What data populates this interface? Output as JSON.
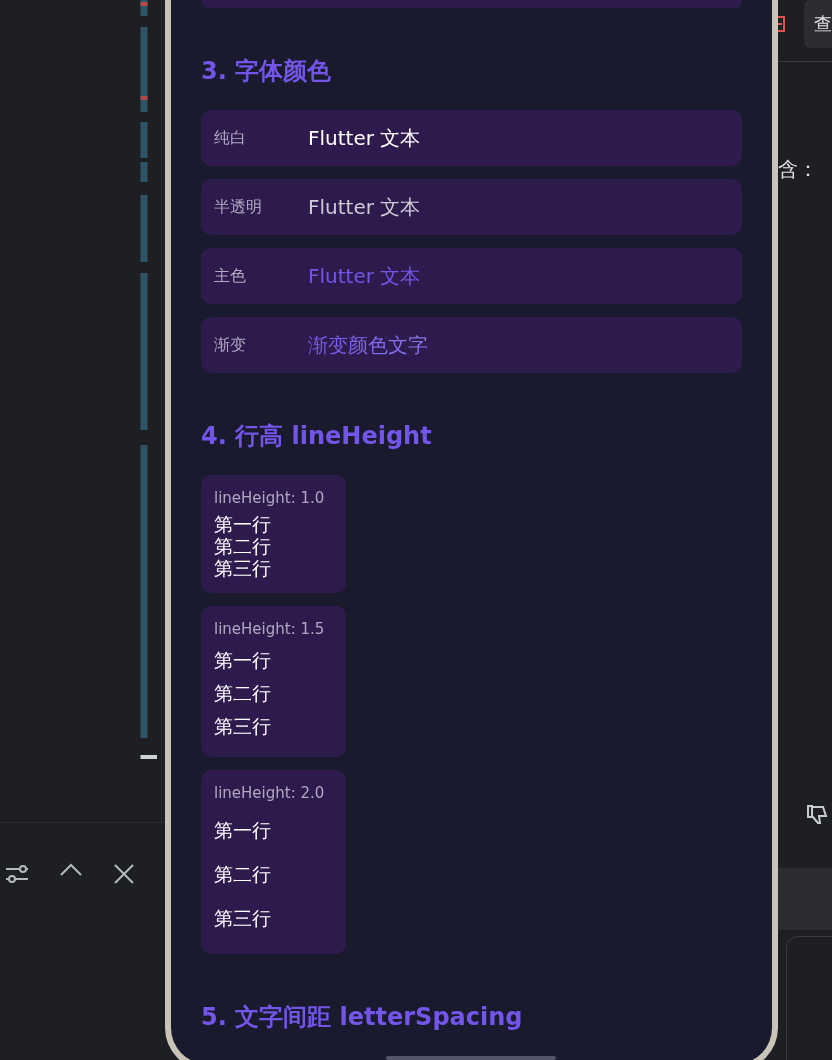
{
  "right_panel": {
    "button": "查",
    "text": "含："
  },
  "phone": {
    "sections": [
      {
        "kind": "colors",
        "title": "3. 字体颜色",
        "rows": [
          {
            "label": "纯白",
            "value": "Flutter 文本",
            "kind": "white"
          },
          {
            "label": "半透明",
            "value": "Flutter 文本",
            "kind": "translucent"
          },
          {
            "label": "主色",
            "value": "Flutter 文本",
            "kind": "primary"
          },
          {
            "label": "渐变",
            "value": "渐变颜色文字",
            "kind": "gradient"
          }
        ]
      },
      {
        "kind": "line_heights",
        "title": "4. 行高 lineHeight",
        "cards": [
          {
            "label": "lineHeight: 1.0",
            "kind": "h10",
            "lines": [
              "第一行",
              "第二行",
              "第三行"
            ]
          },
          {
            "label": "lineHeight: 1.5",
            "kind": "h15",
            "lines": [
              "第一行",
              "第二行",
              "第三行"
            ]
          },
          {
            "label": "lineHeight: 2.0",
            "kind": "h20",
            "lines": [
              "第一行",
              "第二行",
              "第三行"
            ]
          }
        ]
      },
      {
        "kind": "heading",
        "title": "5. 文字间距 letterSpacing"
      }
    ]
  }
}
